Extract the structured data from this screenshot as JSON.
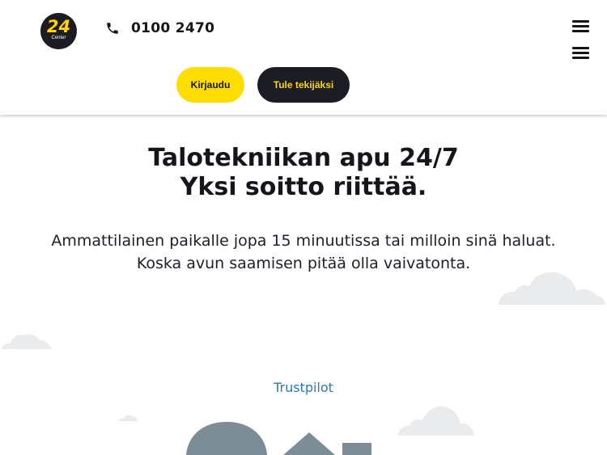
{
  "header": {
    "logo": {
      "number": "24",
      "subtitle": "Center"
    },
    "phone": {
      "icon": "phone-icon",
      "number": "0100 2470"
    },
    "menu_icons": [
      "hamburger-menu-icon",
      "hamburger-menu-icon"
    ],
    "login_label": "Kirjaudu",
    "join_label": "Tule tekijäksi"
  },
  "hero": {
    "title_line1": "Talotekniikan apu 24/7",
    "title_line2": "Yksi soitto riittää.",
    "text_line1": "Ammattilainen paikalle jopa 15 minuutissa tai milloin sinä haluat.",
    "text_line2": "Koska avun saamisen pitää olla vaivatonta."
  },
  "trustpilot": {
    "label": "Trustpilot"
  },
  "colors": {
    "accent_yellow": "#ffdd00",
    "dark": "#1c1c24",
    "link_blue": "#2a7ab8",
    "cloud": "#e8eaec",
    "illustration": "#7d8e99"
  }
}
